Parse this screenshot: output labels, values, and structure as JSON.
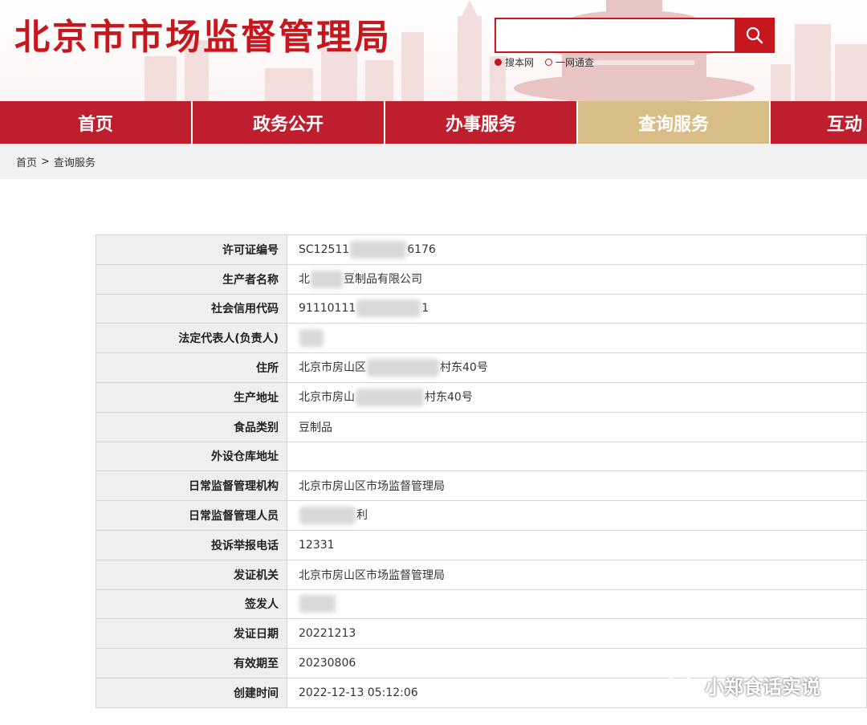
{
  "header": {
    "site_title": "北京市市场监督管理局",
    "search_placeholder": "",
    "search_options": [
      "搜本网",
      "一网通查"
    ]
  },
  "nav": {
    "items": [
      "首页",
      "政务公开",
      "办事服务",
      "查询服务",
      "互动"
    ],
    "active": "查询服务"
  },
  "breadcrumb": {
    "home": "首页",
    "separator": ">",
    "current": "查询服务"
  },
  "license": {
    "rows": [
      {
        "label": "许可证编号",
        "value_pre": "SC12511",
        "value_post": "6176"
      },
      {
        "label": "生产者名称",
        "value_pre": "北",
        "value_post": "豆制品有限公司"
      },
      {
        "label": "社会信用代码",
        "value_pre": "91110111",
        "value_post": "1"
      },
      {
        "label": "法定代表人(负责人)",
        "value_pre": "",
        "value_post": ""
      },
      {
        "label": "住所",
        "value_pre": "北京市房山区",
        "value_post": "村东40号"
      },
      {
        "label": "生产地址",
        "value_pre": "北京市房山",
        "value_post": "村东40号"
      },
      {
        "label": "食品类别",
        "value_pre": "豆制品",
        "value_post": ""
      },
      {
        "label": "外设仓库地址",
        "value_pre": "",
        "value_post": ""
      },
      {
        "label": "日常监督管理机构",
        "value_pre": "北京市房山区市场监督管理局",
        "value_post": ""
      },
      {
        "label": "日常监督管理人员",
        "value_pre": "",
        "value_post": "利"
      },
      {
        "label": "投诉举报电话",
        "value_pre": "12331",
        "value_post": ""
      },
      {
        "label": "发证机关",
        "value_pre": "北京市房山区市场监督管理局",
        "value_post": ""
      },
      {
        "label": "签发人",
        "value_pre": "",
        "value_post": ""
      },
      {
        "label": "发证日期",
        "value_pre": "20221213",
        "value_post": ""
      },
      {
        "label": "有效期至",
        "value_pre": "20230806",
        "value_post": ""
      },
      {
        "label": "创建时间",
        "value_pre": "2022-12-13 05:12:06",
        "value_post": ""
      }
    ]
  },
  "watermark": {
    "text": "小郑食话实说",
    "icon": "wechat-icon"
  },
  "colors": {
    "brand_red": "#c8161d",
    "nav_red": "#be1e2d",
    "nav_active": "#d8bd86",
    "label_bg": "#efefef"
  }
}
